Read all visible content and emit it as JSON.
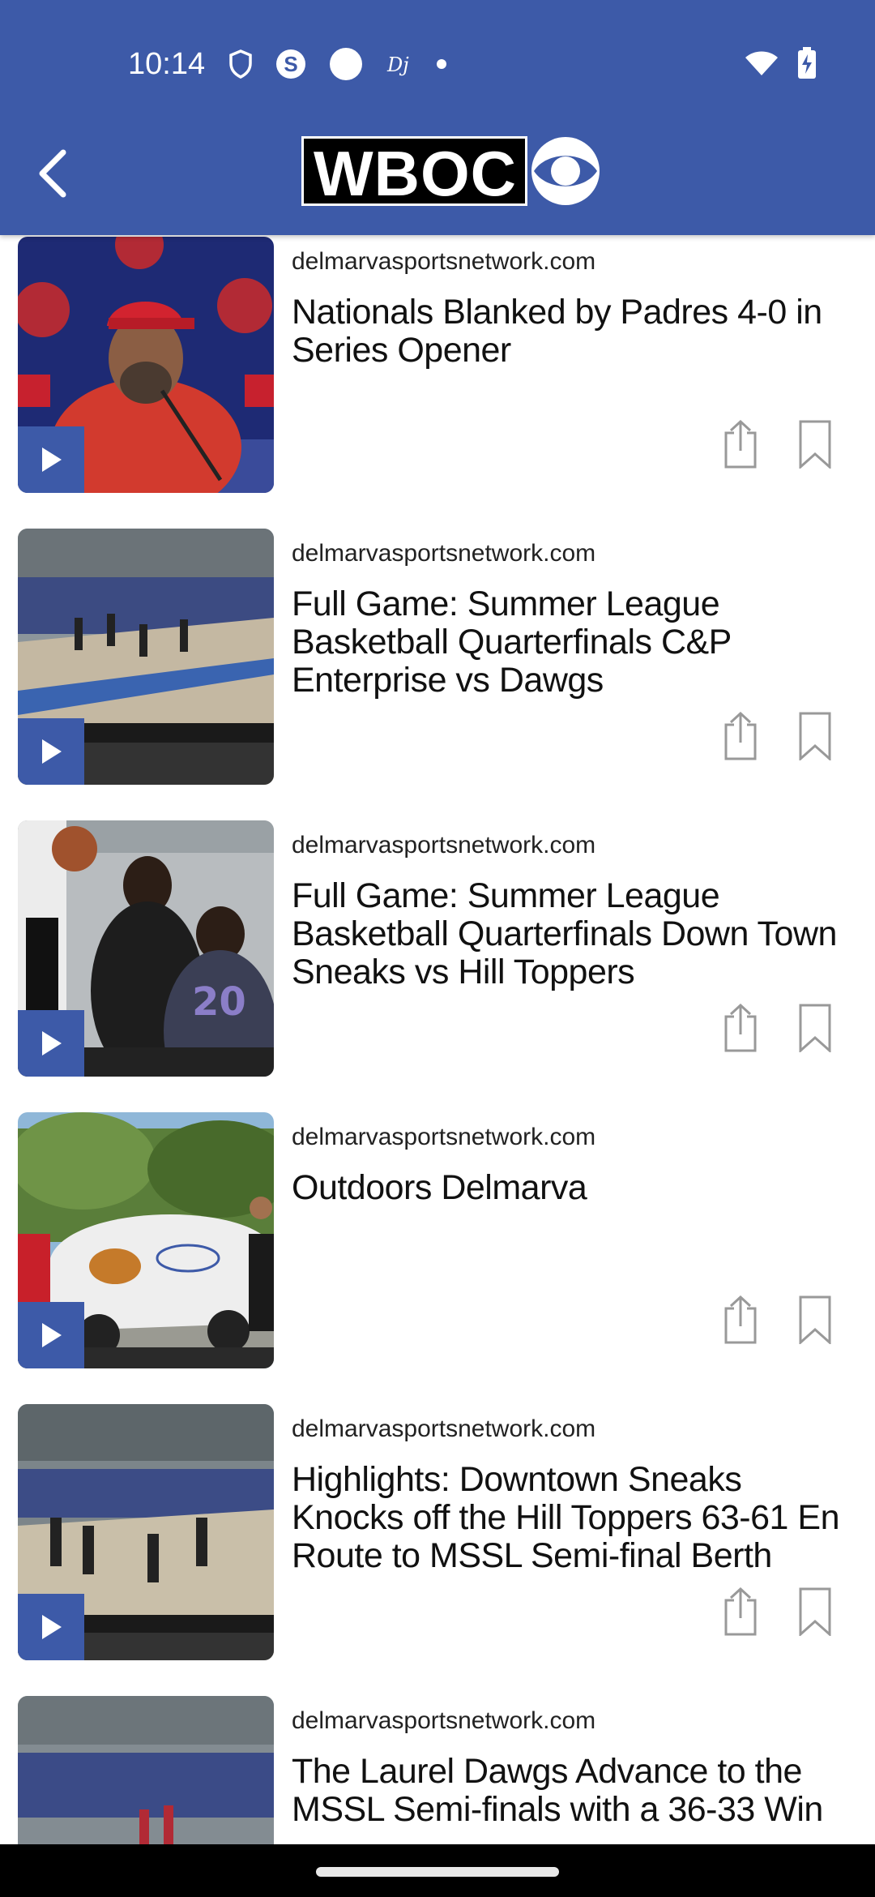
{
  "status_bar": {
    "time": "10:14",
    "icons": [
      "shield-icon",
      "s-icon",
      "circle-icon",
      "dj-icon",
      "dot-icon"
    ],
    "right_icons": [
      "wifi-icon",
      "battery-charging-icon"
    ]
  },
  "header": {
    "logo_text": "WBOC",
    "back_icon": "chevron-left-icon",
    "bg_color": "#3d5aa8"
  },
  "articles": [
    {
      "source": "delmarvasportsnetwork.com",
      "title": "Nationals Blanked by Padres 4-0 in Series Opener"
    },
    {
      "source": "delmarvasportsnetwork.com",
      "title": "Full Game: Summer League Basketball Quarterfinals C&P Enterprise vs Dawgs"
    },
    {
      "source": "delmarvasportsnetwork.com",
      "title": "Full Game: Summer League Basketball Quarterfinals Down Town Sneaks vs Hill Toppers"
    },
    {
      "source": "delmarvasportsnetwork.com",
      "title": "Outdoors Delmarva"
    },
    {
      "source": "delmarvasportsnetwork.com",
      "title": "Highlights: Downtown Sneaks Knocks off the Hill Toppers 63-61 En Route to MSSL Semi-final Berth"
    },
    {
      "source": "delmarvasportsnetwork.com",
      "title": "The Laurel Dawgs Advance to the MSSL Semi-finals with a 36-33 Win"
    }
  ]
}
